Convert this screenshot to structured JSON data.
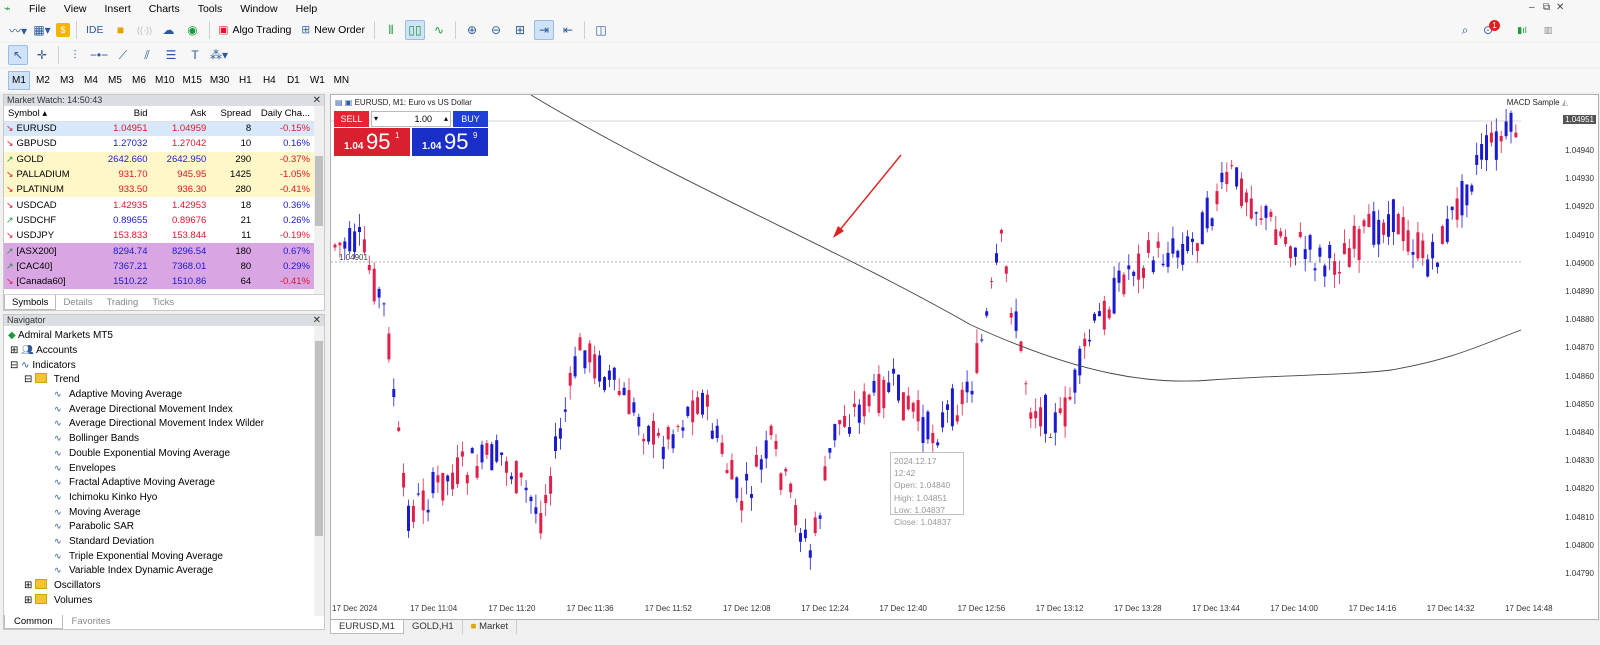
{
  "menu": [
    "File",
    "View",
    "Insert",
    "Charts",
    "Tools",
    "Window",
    "Help"
  ],
  "toolbar": {
    "ide": "IDE",
    "algo": "Algo Trading",
    "new_order": "New Order"
  },
  "timeframes": [
    "M1",
    "M2",
    "M3",
    "M4",
    "M5",
    "M6",
    "M10",
    "M15",
    "M30",
    "H1",
    "H4",
    "D1",
    "W1",
    "MN"
  ],
  "notification_count": "1",
  "market_watch": {
    "title": "Market Watch: 14:50:43",
    "headers": [
      "Symbol",
      "Bid",
      "Ask",
      "Spread",
      "Daily Cha..."
    ],
    "rows": [
      {
        "symbol": "EURUSD",
        "bid": "1.04951",
        "ask": "1.04959",
        "spread": "8",
        "change": "-0.15%",
        "dir": "down"
      },
      {
        "symbol": "GBPUSD",
        "bid": "1.27032",
        "ask": "1.27042",
        "spread": "10",
        "change": "0.16%",
        "dir": "down"
      },
      {
        "symbol": "GOLD",
        "bid": "2642.660",
        "ask": "2642.950",
        "spread": "290",
        "change": "-0.37%",
        "dir": "up"
      },
      {
        "symbol": "PALLADIUM",
        "bid": "931.70",
        "ask": "945.95",
        "spread": "1425",
        "change": "-1.05%",
        "dir": "down"
      },
      {
        "symbol": "PLATINUM",
        "bid": "933.50",
        "ask": "936.30",
        "spread": "280",
        "change": "-0.41%",
        "dir": "down"
      },
      {
        "symbol": "USDCAD",
        "bid": "1.42935",
        "ask": "1.42953",
        "spread": "18",
        "change": "0.36%",
        "dir": "down"
      },
      {
        "symbol": "USDCHF",
        "bid": "0.89655",
        "ask": "0.89676",
        "spread": "21",
        "change": "0.26%",
        "dir": "up"
      },
      {
        "symbol": "USDJPY",
        "bid": "153.833",
        "ask": "153.844",
        "spread": "11",
        "change": "-0.19%",
        "dir": "down"
      },
      {
        "symbol": "[ASX200]",
        "bid": "8294.74",
        "ask": "8296.54",
        "spread": "180",
        "change": "0.67%",
        "dir": "up"
      },
      {
        "symbol": "[CAC40]",
        "bid": "7367.21",
        "ask": "7368.01",
        "spread": "80",
        "change": "0.29%",
        "dir": "up"
      },
      {
        "symbol": "[Canada60]",
        "bid": "1510.22",
        "ask": "1510.86",
        "spread": "64",
        "change": "-0.41%",
        "dir": "down"
      }
    ],
    "tabs": [
      "Symbols",
      "Details",
      "Trading",
      "Ticks"
    ]
  },
  "navigator": {
    "title": "Navigator",
    "root": "Admiral Markets MT5",
    "accounts": "Accounts",
    "indicators": "Indicators",
    "trend": "Trend",
    "trend_items": [
      "Adaptive Moving Average",
      "Average Directional Movement Index",
      "Average Directional Movement Index Wilder",
      "Bollinger Bands",
      "Double Exponential Moving Average",
      "Envelopes",
      "Fractal Adaptive Moving Average",
      "Ichimoku Kinko Hyo",
      "Moving Average",
      "Parabolic SAR",
      "Standard Deviation",
      "Triple Exponential Moving Average",
      "Variable Index Dynamic Average"
    ],
    "oscillators": "Oscillators",
    "volumes": "Volumes",
    "tabs": [
      "Common",
      "Favorites"
    ]
  },
  "chart": {
    "header": "EURUSD, M1:  Euro vs US Dollar",
    "expert": "MACD Sample",
    "trade": {
      "sell": "SELL",
      "buy": "BUY",
      "lot": "1.00",
      "sell_small": "1.04",
      "sell_big": "95",
      "sell_sup": "1",
      "buy_small": "1.04",
      "buy_big": "95",
      "buy_sup": "9"
    },
    "current_price": "1.04951",
    "level_label": "1.04901",
    "tooltip": [
      "2024.12.17 12:42",
      "Open: 1.04840",
      "High: 1.04851",
      "Low: 1.04837",
      "Close: 1.04837"
    ],
    "y_labels": [
      "1.04940",
      "1.04930",
      "1.04920",
      "1.04910",
      "1.04900",
      "1.04890",
      "1.04880",
      "1.04870",
      "1.04860",
      "1.04850",
      "1.04840",
      "1.04830",
      "1.04820",
      "1.04810",
      "1.04800",
      "1.04790"
    ],
    "x_labels": [
      "17 Dec 2024",
      "17 Dec 11:04",
      "17 Dec 11:20",
      "17 Dec 11:36",
      "17 Dec 11:52",
      "17 Dec 12:08",
      "17 Dec 12:24",
      "17 Dec 12:40",
      "17 Dec 12:56",
      "17 Dec 13:12",
      "17 Dec 13:28",
      "17 Dec 13:44",
      "17 Dec 14:00",
      "17 Dec 14:16",
      "17 Dec 14:32",
      "17 Dec 14:48"
    ],
    "colors": {
      "bull": "#1a1ad0",
      "bear": "#e0204a",
      "ma": "#444444",
      "arrow": "#e02020"
    }
  },
  "chart_tabs": [
    "EURUSD,M1",
    "GOLD,H1",
    "Market"
  ]
}
